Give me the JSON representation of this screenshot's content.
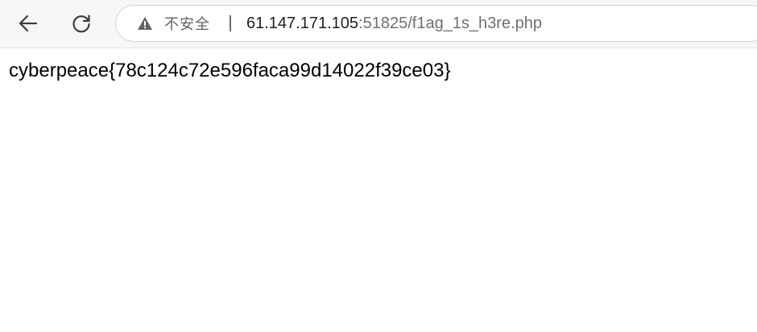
{
  "toolbar": {
    "back_icon": "arrow-left-icon",
    "reload_icon": "reload-icon",
    "security_icon": "warning-triangle-icon",
    "security_label": "不安全",
    "url_host": "61.147.171.105",
    "url_rest": ":51825/f1ag_1s_h3re.php"
  },
  "page": {
    "text": "cyberpeace{78c124c72e596faca99d14022f39ce03}"
  }
}
